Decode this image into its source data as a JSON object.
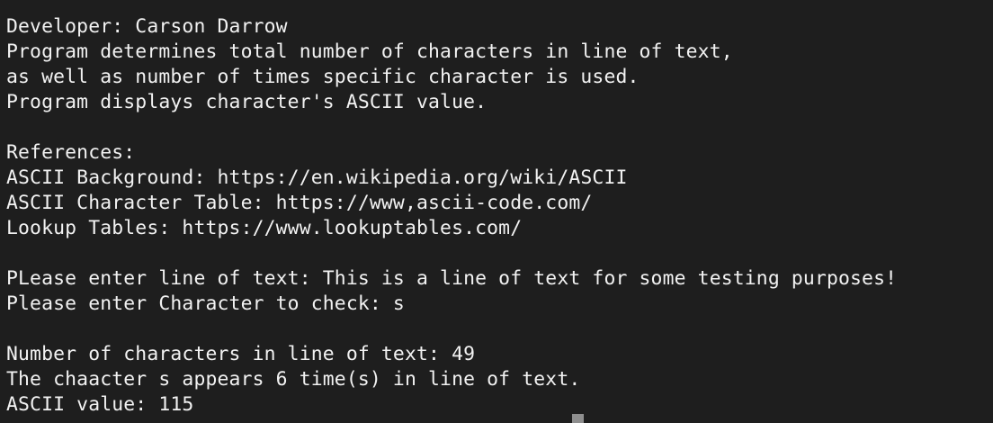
{
  "terminal": {
    "lines": [
      "Developer: Carson Darrow",
      "Program determines total number of characters in line of text,",
      "as well as number of times specific character is used.",
      "Program displays character's ASCII value.",
      "",
      "References:",
      "ASCII Background: https://en.wikipedia.org/wiki/ASCII",
      "ASCII Character Table: https://www,ascii-code.com/",
      "Lookup Tables: https://www.lookuptables.com/",
      "",
      "PLease enter line of text: This is a line of text for some testing purposes!",
      "Please enter Character to check: s",
      "",
      "Number of characters in line of text: 49",
      "The chaacter s appears 6 time(s) in line of text.",
      "ASCII value: 115"
    ],
    "prompt_partial": "",
    "colors": {
      "background": "#1e1e1e",
      "text": "#f2f2f2",
      "cursor": "#8e8e8e"
    }
  }
}
